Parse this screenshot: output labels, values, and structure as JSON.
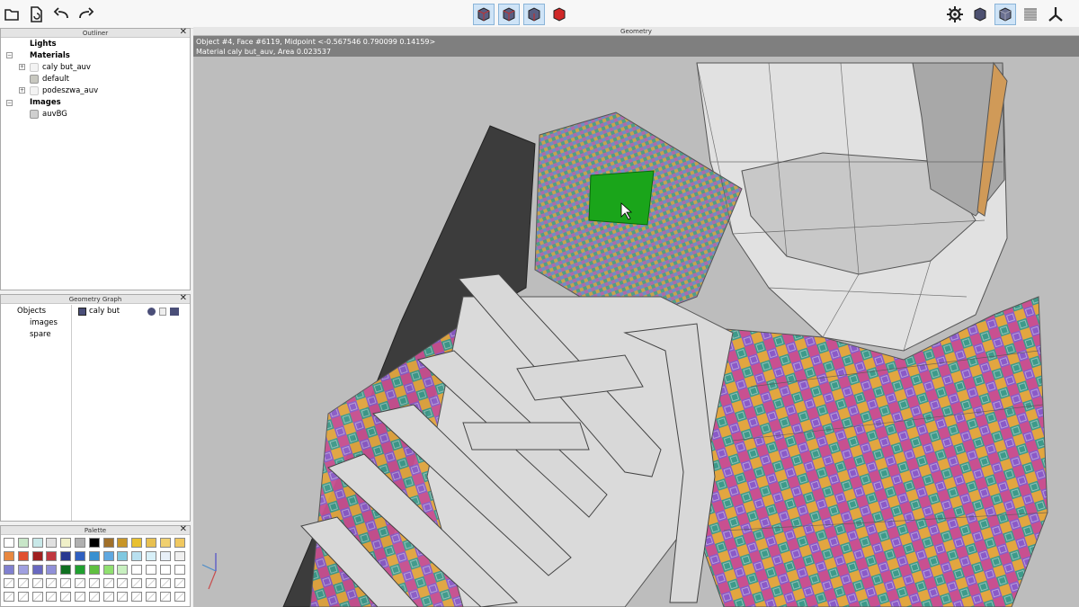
{
  "toolbar": {
    "left_icons": [
      "open-folder-icon",
      "import-icon",
      "undo-icon",
      "redo-icon"
    ],
    "center_icons": [
      "view-cube-front-icon",
      "view-cube-side-icon",
      "view-cube-top-icon",
      "view-cube-red-icon"
    ],
    "right_icons": [
      "settings-gear-icon",
      "shaded-cube-icon",
      "wireframe-cube-icon",
      "texture-gradient-icon",
      "axes-gizmo-icon"
    ]
  },
  "outliner": {
    "title": "Outliner",
    "items": [
      {
        "label": "Lights",
        "bold": true
      },
      {
        "label": "Materials",
        "bold": true
      },
      {
        "label": "caly but_auv",
        "bold": false
      },
      {
        "label": "default",
        "bold": false
      },
      {
        "label": "podeszwa_auv",
        "bold": false
      },
      {
        "label": "Images",
        "bold": true
      },
      {
        "label": "auvBG",
        "bold": false
      }
    ]
  },
  "geometry_graph": {
    "title": "Geometry Graph",
    "left_items": [
      "Objects",
      "images",
      "spare"
    ],
    "object_label": "caly but"
  },
  "palette": {
    "title": "Palette",
    "colors": [
      "#ffffff",
      "#c8e6c8",
      "#c8e8e8",
      "#e0e0e0",
      "#f0f0c8",
      "#b0b0b0",
      "#000000",
      "#a0702a",
      "#c89628",
      "#e8c030",
      "#e8c050",
      "#f0d070",
      "#f0c860",
      "#e88840",
      "#e05030",
      "#a02020",
      "#c03840",
      "#283890",
      "#3060c0",
      "#3890d0",
      "#60a8e0",
      "#80c8e0",
      "#b8e0f0",
      "#d8f0f8",
      "#e8f0f8",
      "#f0f0f0",
      "#8080d0",
      "#a0a0e0",
      "#6868c0",
      "#9090d8",
      "#107020",
      "#20a030",
      "#60c040",
      "#90e070",
      "#c8f0c0",
      "#ffffff",
      "#ffffff",
      "#ffffff",
      "#ffffff"
    ]
  },
  "viewport": {
    "title": "Geometry",
    "info_line1": "Object #4, Face #6119, Midpoint <-0.567546  0.790099  0.14159>",
    "info_line2": "Material caly but_auv, Area 0.023537"
  }
}
